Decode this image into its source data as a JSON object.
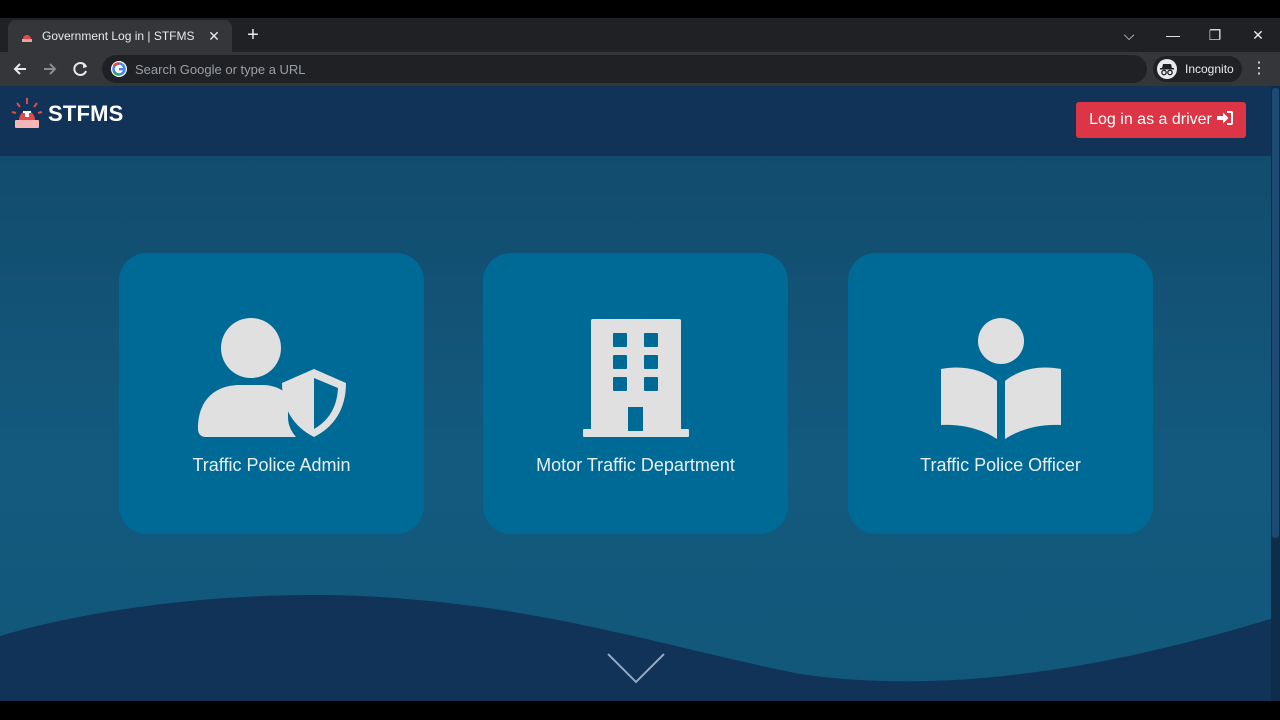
{
  "browser": {
    "tab": {
      "title": "Government Log in | STFMS",
      "close": "✕"
    },
    "new_tab": "+",
    "window_controls": {
      "tab_search": "⌵",
      "minimize": "—",
      "restore": "❐",
      "close": "✕"
    },
    "omnibox": {
      "placeholder": "Search Google or type a URL"
    },
    "profile": {
      "label": "Incognito"
    },
    "menu": "⋮"
  },
  "header": {
    "brand": "STFMS",
    "driver_login": {
      "label": "Log in as a driver",
      "icon": "➔"
    }
  },
  "cards": [
    {
      "label": "Traffic Police Admin",
      "icon": "user-shield-icon"
    },
    {
      "label": "Motor Traffic Department",
      "icon": "building-icon"
    },
    {
      "label": "Traffic Police Officer",
      "icon": "book-reader-icon"
    }
  ],
  "colors": {
    "accent": "#dc3545",
    "card": "#006a96",
    "header": "#113358",
    "icon": "#e0e0e0"
  }
}
